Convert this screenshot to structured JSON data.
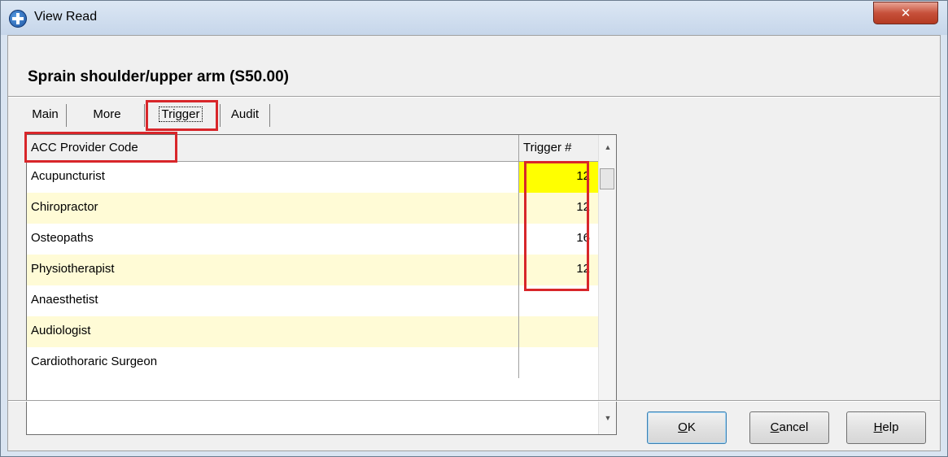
{
  "window": {
    "title": "View Read",
    "close_glyph": "✕"
  },
  "record_title": "Sprain shoulder/upper arm (S50.00)",
  "tabs": [
    {
      "label": "Main"
    },
    {
      "label": "More"
    },
    {
      "label": "Trigger",
      "active": true
    },
    {
      "label": "Audit"
    }
  ],
  "grid": {
    "columns": [
      "ACC Provider Code",
      "Trigger #"
    ],
    "rows": [
      {
        "code": "Acupuncturist",
        "trigger": "12"
      },
      {
        "code": "Chiropractor",
        "trigger": "12"
      },
      {
        "code": "Osteopaths",
        "trigger": "16"
      },
      {
        "code": "Physiotherapist",
        "trigger": "12"
      },
      {
        "code": "Anaesthetist",
        "trigger": ""
      },
      {
        "code": "Audiologist",
        "trigger": ""
      },
      {
        "code": "Cardiothoraric Surgeon",
        "trigger": ""
      }
    ],
    "scroll_up_glyph": "▲",
    "scroll_down_glyph": "▼"
  },
  "buttons": {
    "ok": {
      "mnemonic": "O",
      "rest": "K"
    },
    "cancel": {
      "mnemonic": "C",
      "rest": "ancel"
    },
    "help": {
      "mnemonic": "H",
      "rest": "elp"
    }
  },
  "colors": {
    "highlight_yellow": "#ffff00",
    "alt_row": "#fffbd6",
    "annotation_red": "#d8262a"
  },
  "icons": [
    "app-cross-icon",
    "close-icon",
    "scroll-up-arrow-icon",
    "scroll-down-arrow-icon"
  ]
}
